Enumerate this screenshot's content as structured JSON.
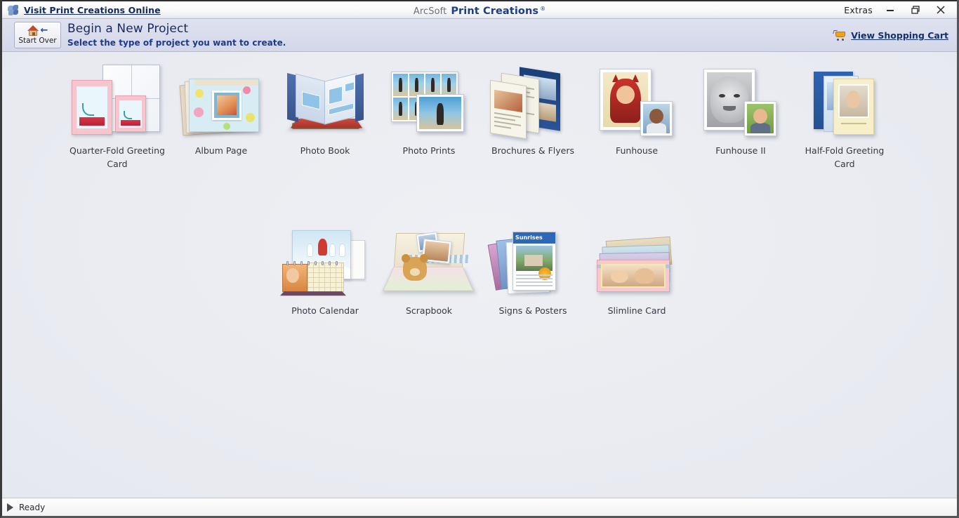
{
  "titlebar": {
    "app_icon": "arcsoft-flower-icon",
    "visit_link": "Visit Print Creations Online",
    "brand_prefix": "ArcSoft",
    "brand_name": "Print Creations",
    "brand_registered": "®",
    "extras_label": "Extras",
    "minimize_icon": "minimize-icon",
    "maximize_icon": "maximize-restore-icon",
    "close_icon": "close-icon"
  },
  "header": {
    "start_over_label": "Start Over",
    "start_over_icon": "home-back-icon",
    "title": "Begin a New Project",
    "subtitle": "Select the type of project you want to create.",
    "cart_icon": "shopping-cart-icon",
    "cart_label": "View Shopping Cart"
  },
  "projects": {
    "row1": [
      {
        "id": "quarter-fold-greeting-card",
        "label": "Quarter-Fold Greeting\nCard"
      },
      {
        "id": "album-page",
        "label": "Album Page"
      },
      {
        "id": "photo-book",
        "label": "Photo Book"
      },
      {
        "id": "photo-prints",
        "label": "Photo Prints"
      },
      {
        "id": "brochures-and-flyers",
        "label": "Brochures & Flyers"
      },
      {
        "id": "funhouse",
        "label": "Funhouse"
      },
      {
        "id": "funhouse-ii",
        "label": "Funhouse II"
      },
      {
        "id": "half-fold-greeting-card",
        "label": "Half-Fold Greeting\nCard"
      }
    ],
    "row2": [
      {
        "id": "photo-calendar",
        "label": "Photo Calendar"
      },
      {
        "id": "scrapbook",
        "label": "Scrapbook"
      },
      {
        "id": "signs-and-posters",
        "label": "Signs & Posters"
      },
      {
        "id": "slimline-card",
        "label": "Slimline Card"
      }
    ]
  },
  "statusbar": {
    "indicator_icon": "play-triangle-icon",
    "text": "Ready"
  },
  "colors": {
    "title_link": "#13295f",
    "brand_blue": "#1d3d86",
    "header_band": "#d9dcec",
    "canvas_bg": "#e9ebf1",
    "label_text": "#35393f"
  }
}
